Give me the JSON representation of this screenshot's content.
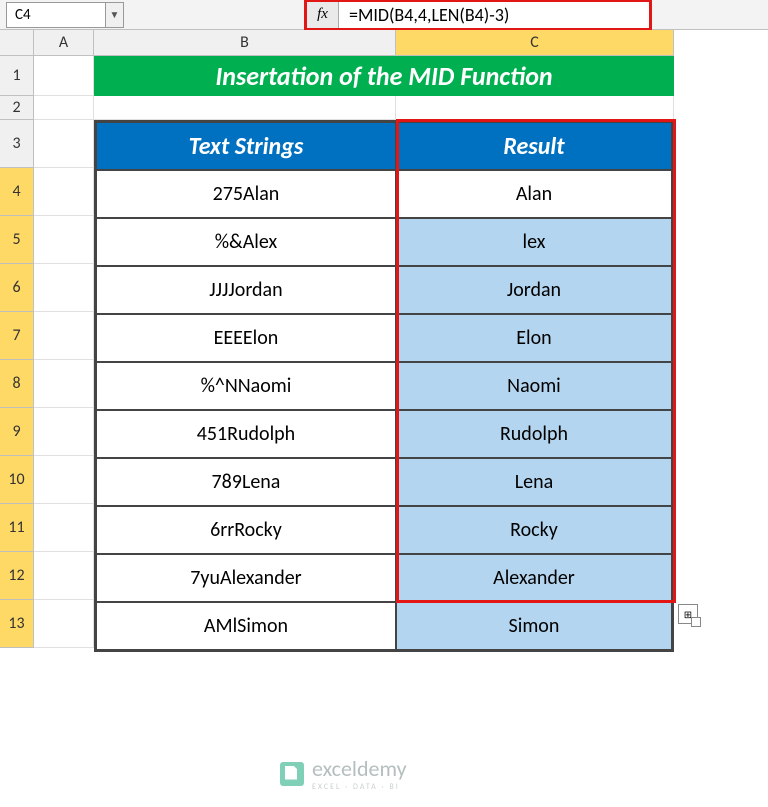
{
  "name_box": "C4",
  "formula": "=MID(B4,4,LEN(B4)-3)",
  "fx_label": "fx",
  "col_headers": [
    "A",
    "B",
    "C"
  ],
  "row_headers": [
    1,
    2,
    3,
    4,
    5,
    6,
    7,
    8,
    9,
    10,
    11,
    12,
    13
  ],
  "title": "Insertation of the MID Function",
  "table": {
    "headers": {
      "textStrings": "Text Strings",
      "result": "Result"
    },
    "rows": [
      {
        "text": "275Alan",
        "result": "Alan"
      },
      {
        "text": "%&Alex",
        "result": "lex"
      },
      {
        "text": "JJJJordan",
        "result": "Jordan"
      },
      {
        "text": "EEEElon",
        "result": "Elon"
      },
      {
        "text": "%^NNaomi",
        "result": "Naomi"
      },
      {
        "text": "451Rudolph",
        "result": "Rudolph"
      },
      {
        "text": "789Lena",
        "result": "Lena"
      },
      {
        "text": "6rrRocky",
        "result": "Rocky"
      },
      {
        "text": "7yuAlexander",
        "result": "Alexander"
      },
      {
        "text": "AMlSimon",
        "result": "Simon"
      }
    ]
  },
  "watermark": {
    "name": "exceldemy",
    "sub": "EXCEL · DATA · BI"
  },
  "chart_data": {
    "type": "table",
    "title": "Insertation of the MID Function",
    "columns": [
      "Text Strings",
      "Result"
    ],
    "rows": [
      [
        "275Alan",
        "Alan"
      ],
      [
        "%&Alex",
        "lex"
      ],
      [
        "JJJJordan",
        "Jordan"
      ],
      [
        "EEEElon",
        "Elon"
      ],
      [
        "%^NNaomi",
        "Naomi"
      ],
      [
        "451Rudolph",
        "Rudolph"
      ],
      [
        "789Lena",
        "Lena"
      ],
      [
        "6rrRocky",
        "Rocky"
      ],
      [
        "7yuAlexander",
        "Alexander"
      ],
      [
        "AMlSimon",
        "Simon"
      ]
    ]
  }
}
